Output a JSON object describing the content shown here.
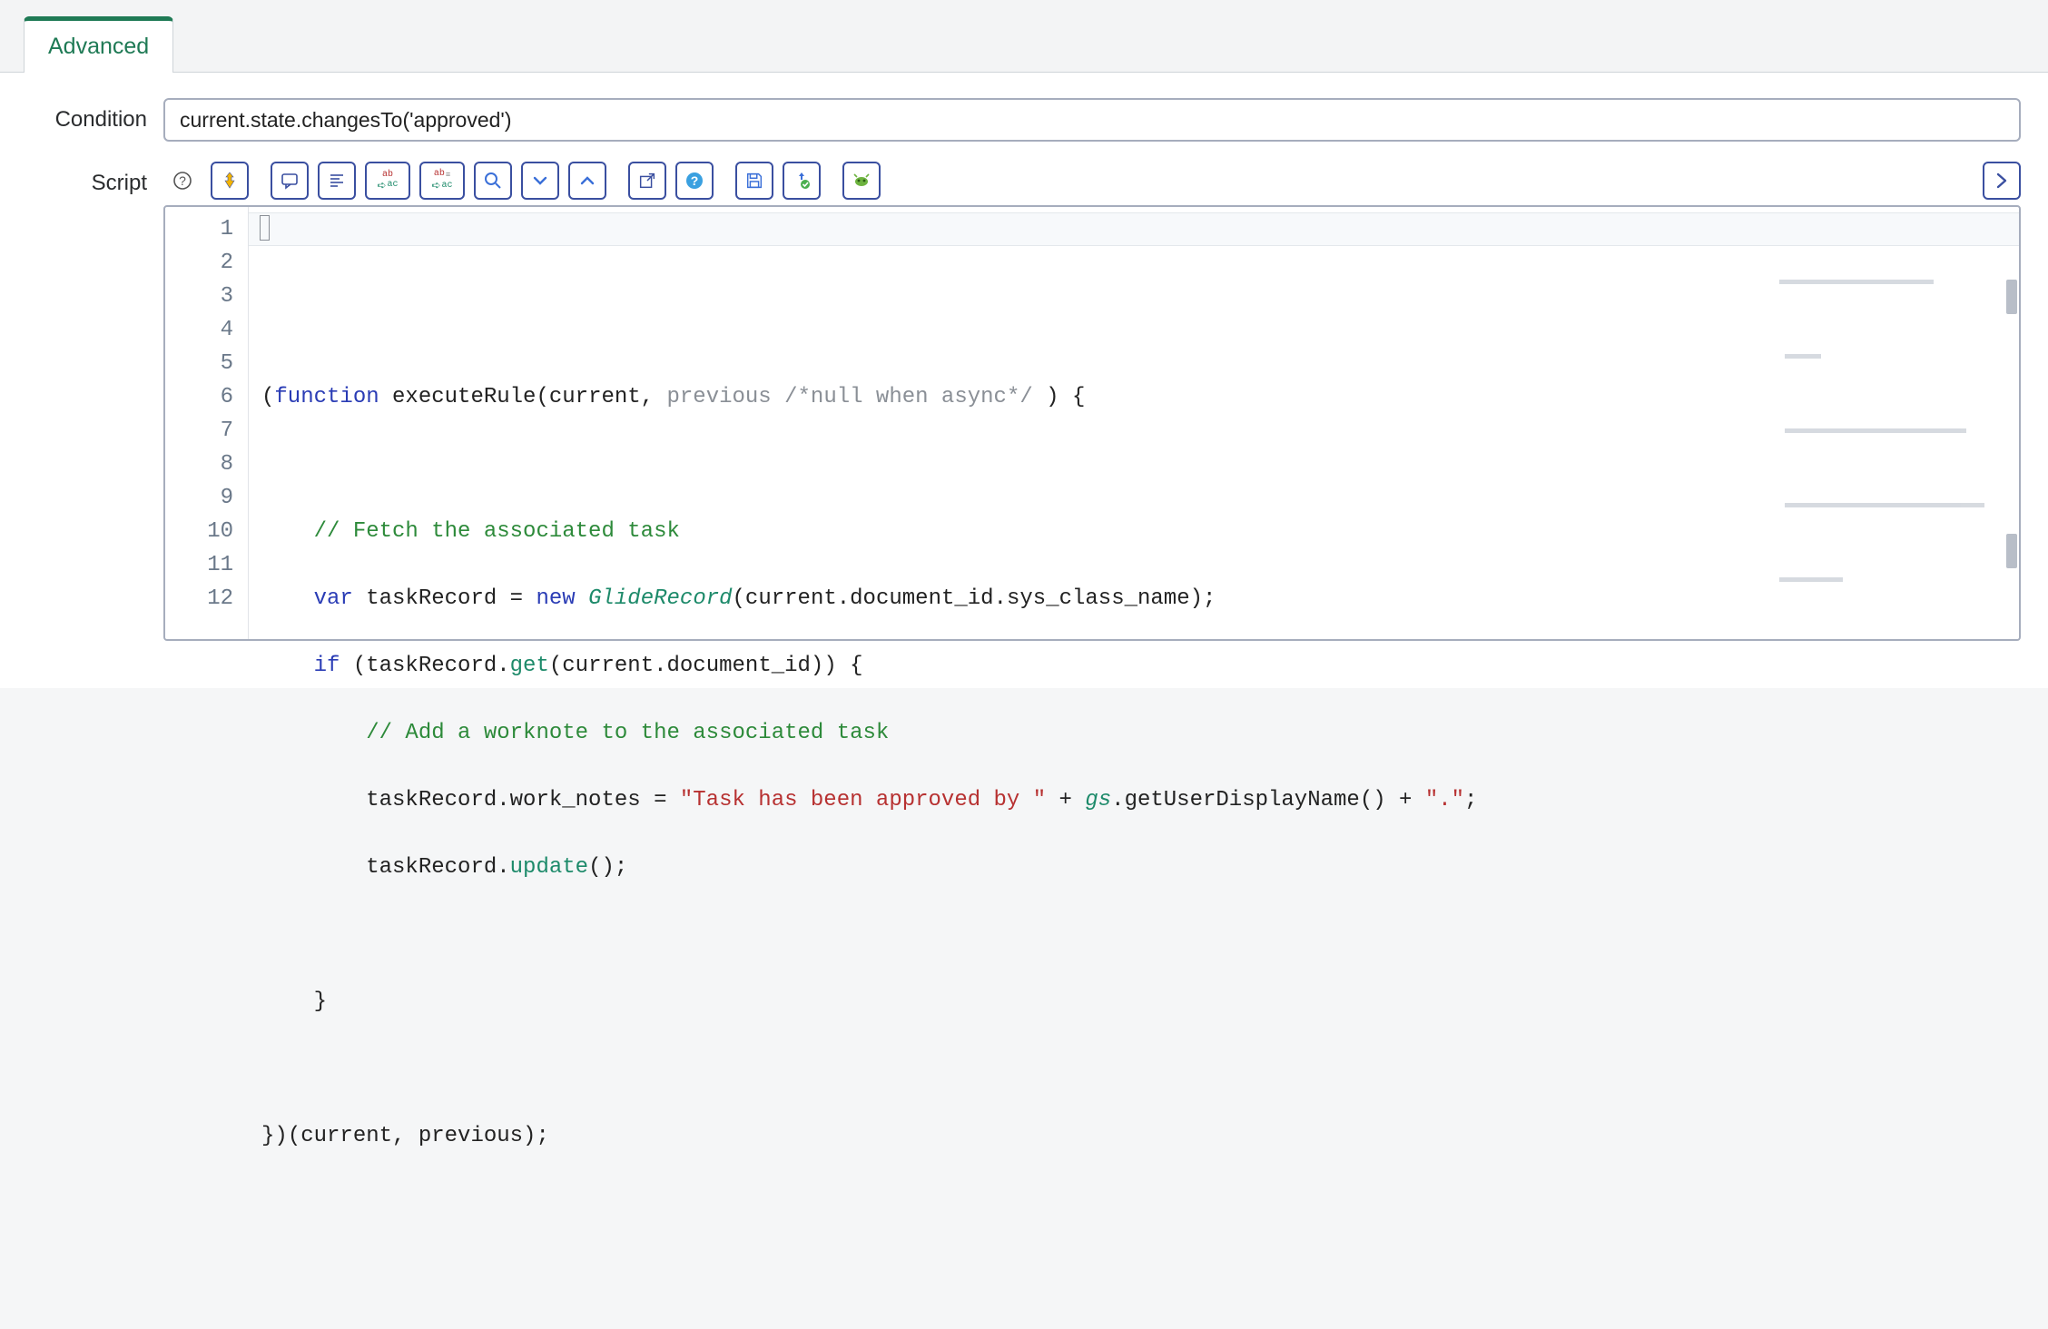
{
  "tabs": {
    "active": {
      "label": "Advanced"
    }
  },
  "fields": {
    "condition": {
      "label": "Condition",
      "value": "current.state.changesTo('approved')"
    },
    "script": {
      "label": "Script"
    }
  },
  "toolbar": {
    "icons": {
      "help": "help-circle-icon",
      "syntax": "syntax-toggle-icon",
      "comment": "comment-icon",
      "format": "format-code-icon",
      "replace": "find-replace-icon",
      "replace_all": "find-replace-all-icon",
      "search": "search-icon",
      "find_next": "chevron-down-icon",
      "find_prev": "chevron-up-icon",
      "popout": "popout-icon",
      "info": "info-circle-icon",
      "save": "save-icon",
      "script_debugger": "script-debugger-icon",
      "context": "context-icon",
      "expand": "chevron-right-icon"
    }
  },
  "editor": {
    "line_numbers": [
      "1",
      "2",
      "3",
      "4",
      "5",
      "6",
      "7",
      "8",
      "9",
      "10",
      "11",
      "12"
    ],
    "code": {
      "l1": {
        "a": "(",
        "b": "function",
        "c": " executeRule",
        "d": "(current, ",
        "e": "previous",
        "f": " /*null when async*/",
        "g": " ) {"
      },
      "l2": "",
      "l3": "    // Fetch the associated task",
      "l4": {
        "a": "    ",
        "b": "var",
        "c": " taskRecord = ",
        "d": "new",
        "e": " ",
        "f": "GlideRecord",
        "g": "(current.document_id.sys_class_name);"
      },
      "l5": {
        "a": "    ",
        "b": "if",
        "c": " (taskRecord.",
        "d": "get",
        "e": "(current.document_id)) {"
      },
      "l6": "        // Add a worknote to the associated task",
      "l7": {
        "a": "        taskRecord.work_notes = ",
        "b": "\"Task has been approved by \"",
        "c": " + ",
        "d": "gs",
        "e": ".getUserDisplayName() + ",
        "f": "\".\"",
        "g": ";"
      },
      "l8": {
        "a": "        taskRecord.",
        "b": "update",
        "c": "();"
      },
      "l9": "",
      "l10": "    }",
      "l11": "",
      "l12": {
        "a": "})",
        "b": "(current, previous);"
      }
    }
  }
}
